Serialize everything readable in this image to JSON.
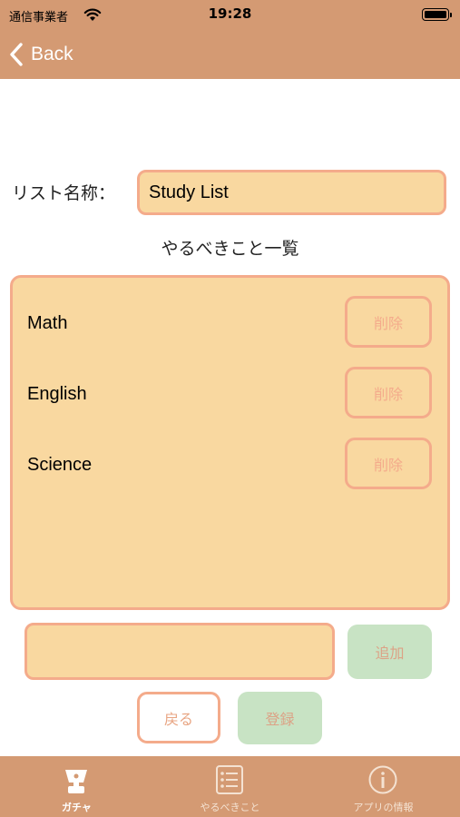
{
  "status_bar": {
    "carrier": "通信事業者",
    "time": "19:28"
  },
  "nav": {
    "back_label": "Back"
  },
  "form": {
    "list_name_label": "リスト名称：",
    "list_name_value": "Study List",
    "todo_heading": "やるべきこと一覧"
  },
  "todo_list": {
    "items": [
      {
        "label": "Math",
        "delete_label": "削除"
      },
      {
        "label": "English",
        "delete_label": "削除"
      },
      {
        "label": "Science",
        "delete_label": "削除"
      }
    ]
  },
  "new_todo": {
    "value": "",
    "add_label": "追加"
  },
  "actions": {
    "back_label": "戻る",
    "register_label": "登録"
  },
  "tab_bar": {
    "tabs": [
      {
        "label": "ガチャ",
        "icon": "gacha-icon",
        "active": true
      },
      {
        "label": "やるべきこと",
        "icon": "list-icon",
        "active": false
      },
      {
        "label": "アプリの情報",
        "icon": "info-icon",
        "active": false
      }
    ]
  },
  "colors": {
    "header_background": "#d49a73",
    "field_background": "#f9d8a0",
    "field_border": "#f4ab8b",
    "confirm_button": "#c8e3c4"
  }
}
